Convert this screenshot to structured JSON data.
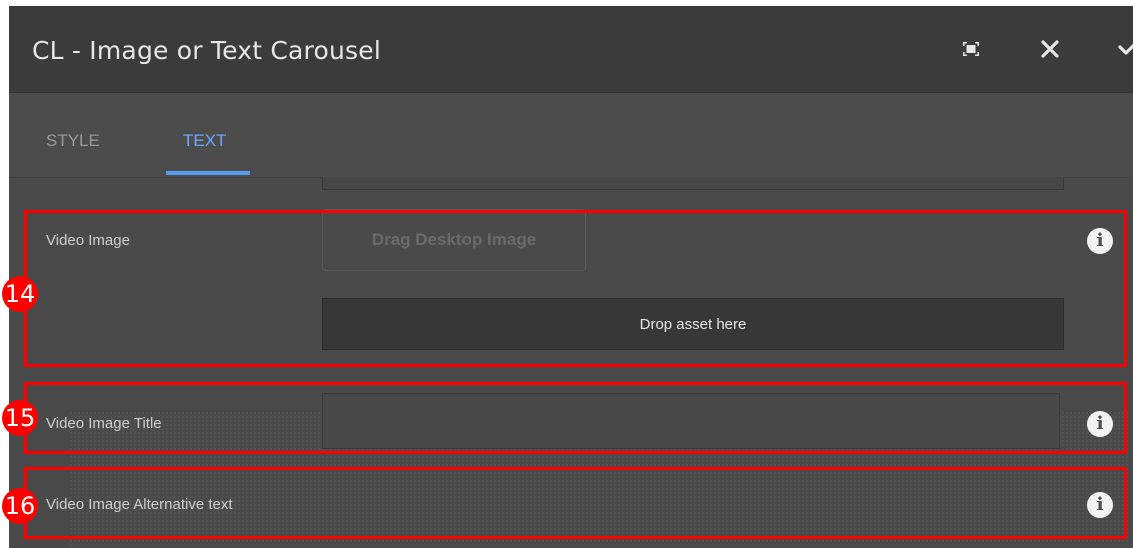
{
  "dialog": {
    "title": "CL - Image or Text Carousel",
    "icons": {
      "fullscreen": "fullscreen-icon",
      "close": "close-icon",
      "confirm": "checkmark-icon"
    }
  },
  "tabs": [
    {
      "label": "STYLE",
      "active": false
    },
    {
      "label": "TEXT",
      "active": true
    }
  ],
  "fields": {
    "video_image": {
      "label": "Video Image",
      "drag_button_label": "Drag Desktop Image",
      "dropzone_label": "Drop asset here",
      "info_icon": "info-icon"
    },
    "video_image_title": {
      "label": "Video Image Title",
      "value": "",
      "info_icon": "info-icon"
    },
    "video_image_alt_text": {
      "label": "Video Image Alternative text",
      "info_icon": "info-icon"
    }
  },
  "annotations": [
    {
      "number": "14",
      "color": "#ff0000"
    },
    {
      "number": "15",
      "color": "#ff0000"
    },
    {
      "number": "16",
      "color": "#ff0000"
    }
  ],
  "colors": {
    "accent": "#5a9cf2",
    "annotation": "#ff0000",
    "panel_bg": "#4a4a4a",
    "header_bg": "#3b3b3b"
  }
}
